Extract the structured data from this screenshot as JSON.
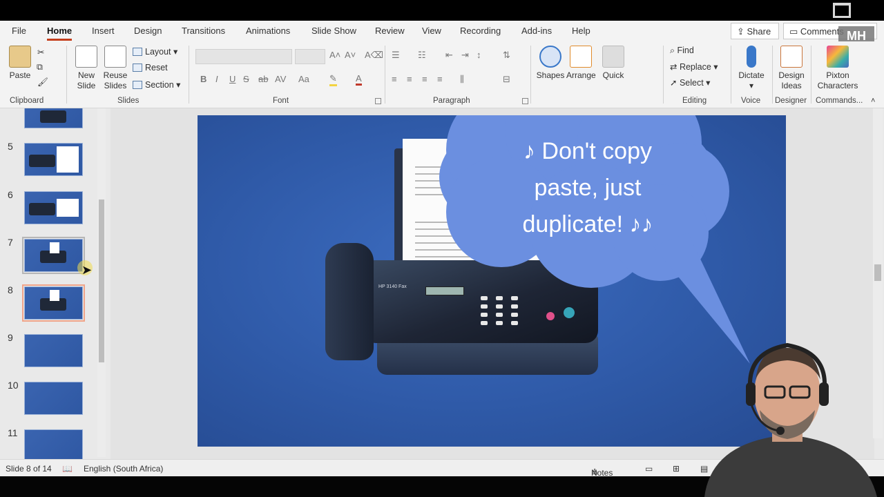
{
  "menu": {
    "tabs": [
      "File",
      "Home",
      "Insert",
      "Design",
      "Transitions",
      "Animations",
      "Slide Show",
      "Review",
      "View",
      "Recording",
      "Add-ins",
      "Help"
    ],
    "active_tab": "Home",
    "share_label": "Share",
    "comments_label": "Comments",
    "logo_text": "MH"
  },
  "ribbon": {
    "clipboard": {
      "paste": "Paste",
      "label": "Clipboard"
    },
    "slides": {
      "new_slide_1": "New",
      "new_slide_2": "Slide",
      "reuse_1": "Reuse",
      "reuse_2": "Slides",
      "layout": "Layout",
      "reset": "Reset",
      "section": "Section",
      "label": "Slides"
    },
    "font": {
      "bold": "B",
      "italic": "I",
      "underline": "U",
      "strike": "ab",
      "spacing": "AV",
      "case": "Aa",
      "label": "Font"
    },
    "paragraph": {
      "label": "Paragraph"
    },
    "drawing": {
      "shapes": "Shapes",
      "arrange": "Arrange",
      "quick": "Quick"
    },
    "editing": {
      "find": "Find",
      "replace": "Replace",
      "select": "Select",
      "label": "Editing"
    },
    "voice": {
      "dictate": "Dictate",
      "label": "Voice"
    },
    "designer": {
      "design_ideas_1": "Design",
      "design_ideas_2": "Ideas",
      "label": "Designer"
    },
    "commands": {
      "pixton_1": "Pixton",
      "pixton_2": "Characters",
      "label": "Commands..."
    }
  },
  "thumbnails": [
    {
      "num": "",
      "kind": "fax"
    },
    {
      "num": "5",
      "kind": "fax-doc"
    },
    {
      "num": "6",
      "kind": "fax-doc"
    },
    {
      "num": "7",
      "kind": "fax"
    },
    {
      "num": "8",
      "kind": "fax"
    },
    {
      "num": "9",
      "kind": "blank"
    },
    {
      "num": "10",
      "kind": "blank"
    },
    {
      "num": "11",
      "kind": "blank"
    }
  ],
  "slide": {
    "speech_line1": "♪  Don't copy",
    "speech_line2": "paste, just",
    "speech_line3": "duplicate! ♪♪",
    "fax_brand": "HP 3140 Fax"
  },
  "status": {
    "slide_info": "Slide 8 of 14",
    "language": "English (South Africa)",
    "notes": "Notes"
  },
  "colors": {
    "accent": "#c43e1c",
    "slide_bg": "#2f5aa8",
    "cloud": "#6b8fe0"
  }
}
